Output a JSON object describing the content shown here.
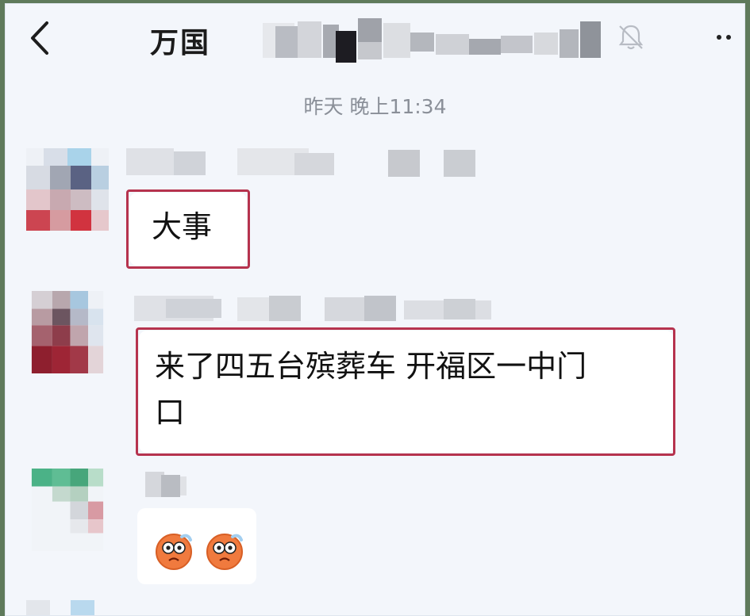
{
  "header": {
    "title": "万国",
    "back_icon": "chevron-left-icon",
    "mute_icon": "bell-off-icon",
    "more_icon": "more-dots-icon"
  },
  "timestamp": "昨天 晚上11:34",
  "messages": [
    {
      "text": "大事"
    },
    {
      "text_line1": "来了四五台殡葬车 开福区一中门",
      "text_line2": "口"
    },
    {
      "emojis": [
        "worried-face-emoji",
        "worried-face-emoji"
      ]
    }
  ],
  "colors": {
    "background": "#f3f6fb",
    "bubble": "#ffffff",
    "highlight_border": "#b6334e",
    "timestamp": "#8a8f98"
  }
}
